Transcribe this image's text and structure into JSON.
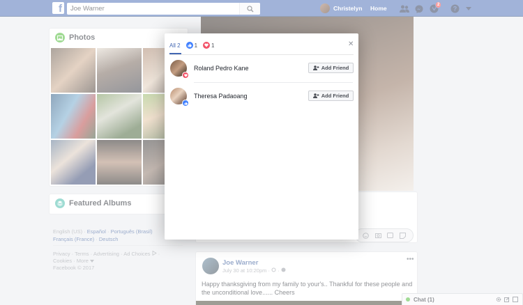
{
  "topbar": {
    "logo": "f",
    "search_value": "Joe Warner",
    "profile_name": "Christelyn",
    "home_label": "Home",
    "notifications_count": "2"
  },
  "left": {
    "photos_title": "Photos",
    "albums_title": "Featured Albums",
    "languages": [
      "English (US)",
      "Español",
      "Português (Brasil)",
      "Français (France)",
      "Deutsch"
    ],
    "footer_links": [
      "Privacy",
      "Terms",
      "Advertising",
      "Ad Choices",
      "Cookies",
      "More"
    ],
    "copyright": "Facebook © 2017"
  },
  "post": {
    "author": "Joe Warner",
    "date": "July 30 at 10:20pm",
    "text": "Happy thanksgiving from my family to your's.. Thankful for these people and the unconditional love...... Cheers"
  },
  "chat": {
    "label": "Chat (1)"
  },
  "dialog": {
    "tabs": [
      {
        "label": "All 2"
      },
      {
        "label": "1",
        "icon": "like-icon"
      },
      {
        "label": "1",
        "icon": "love-icon"
      }
    ],
    "people": [
      {
        "name": "Roland Pedro Kane",
        "reaction": "love-icon",
        "button": "Add Friend"
      },
      {
        "name": "Theresa Padaoang",
        "reaction": "like-icon",
        "button": "Add Friend"
      }
    ]
  },
  "colors": {
    "brand": "#4267b2",
    "like": "#4080ff",
    "love": "#f25268",
    "online": "#42b72a"
  }
}
